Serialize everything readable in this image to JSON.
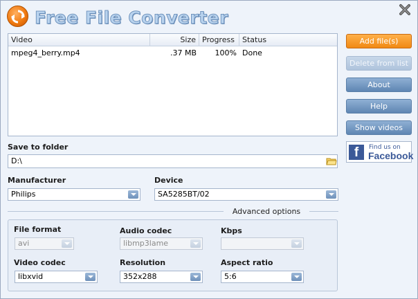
{
  "app": {
    "title": "Free File Converter"
  },
  "list": {
    "columns": [
      "Video",
      "Size",
      "Progress",
      "Status"
    ],
    "rows": [
      {
        "video": "mpeg4_berry.mp4",
        "size": ".37 MB",
        "progress": "100%",
        "status": "Done"
      }
    ]
  },
  "buttons": {
    "add": "Add file(s)",
    "delete": "Delete from list",
    "about": "About",
    "help": "Help",
    "show": "Show videos"
  },
  "facebook": {
    "small": "Find us on",
    "big": "Facebook"
  },
  "save": {
    "label": "Save to folder",
    "value": "D:\\"
  },
  "manufacturer": {
    "label": "Manufacturer",
    "value": "Philips"
  },
  "device": {
    "label": "Device",
    "value": "SA5285BT/02"
  },
  "advanced": {
    "label": "Advanced options",
    "file_format": {
      "label": "File format",
      "value": "avi"
    },
    "audio_codec": {
      "label": "Audio codec",
      "value": "libmp3lame"
    },
    "kbps": {
      "label": "Kbps",
      "value": ""
    },
    "video_codec": {
      "label": "Video codec",
      "value": "libxvid"
    },
    "resolution": {
      "label": "Resolution",
      "value": "352x288"
    },
    "aspect": {
      "label": "Aspect ratio",
      "value": "5:6"
    }
  },
  "icons": {
    "logo": "refresh-arrows-icon",
    "close": "close-icon",
    "folder": "folder-icon",
    "dropdown": "chevron-down-icon"
  },
  "colors": {
    "accent": "#f08a14",
    "button": "#5f86b3",
    "facebook": "#3b5998"
  }
}
